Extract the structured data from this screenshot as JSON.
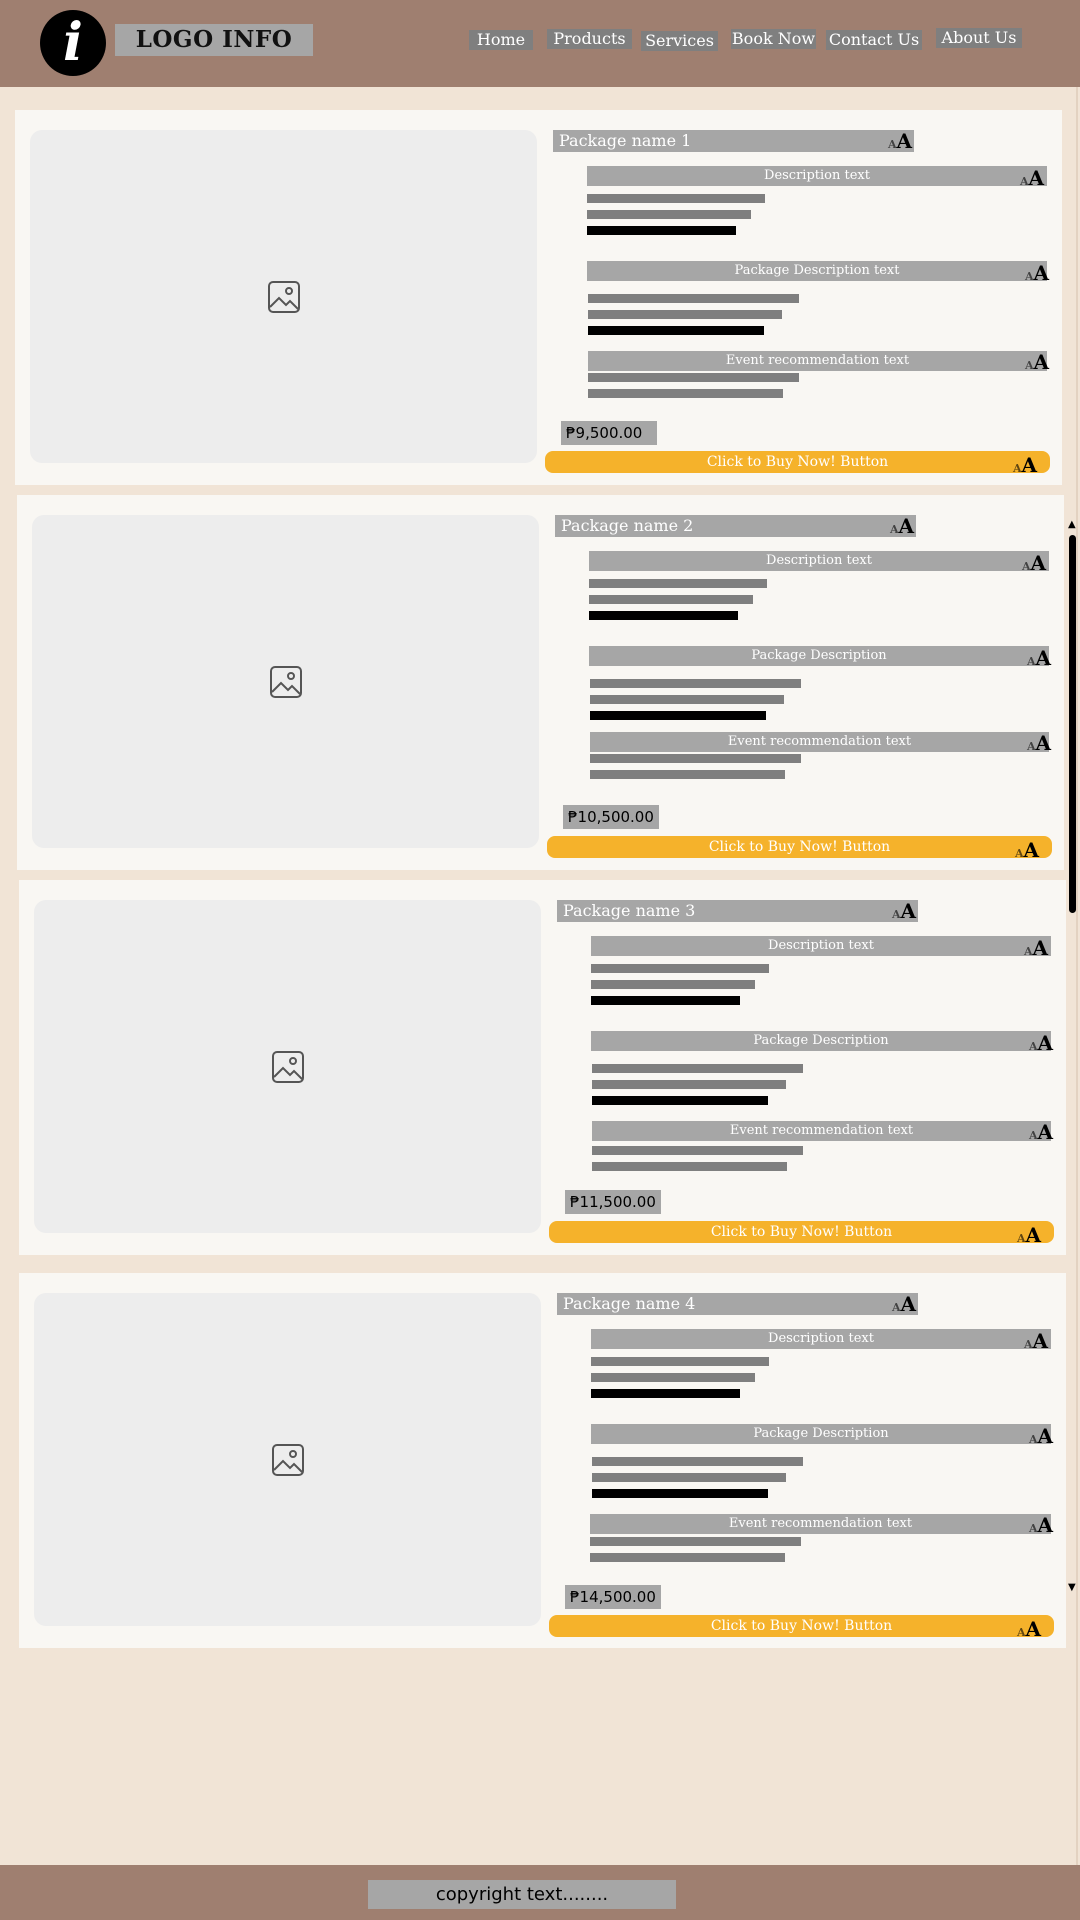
{
  "header": {
    "logo_glyph": "i",
    "logo_text": "LOGO INFO",
    "nav": [
      "Home",
      "Products",
      "Services",
      "Book Now",
      "Contact Us",
      "About Us"
    ]
  },
  "packages": [
    {
      "name": "Package name 1",
      "description_label": "Description text",
      "package_description_label": "Package Description text",
      "event_label": "Event recommendation text",
      "price": "₱9,500.00",
      "buy_label": "Click to Buy Now! Button"
    },
    {
      "name": "Package name 2",
      "description_label": "Description text",
      "package_description_label": "Package Description",
      "event_label": "Event recommendation text",
      "price": "₱10,500.00",
      "buy_label": "Click to Buy Now! Button"
    },
    {
      "name": "Package name 3",
      "description_label": "Description text",
      "package_description_label": "Package Description",
      "event_label": "Event recommendation text",
      "price": "₱11,500.00",
      "buy_label": "Click to Buy Now! Button"
    },
    {
      "name": "Package name 4",
      "description_label": "Description text",
      "package_description_label": "Package Description",
      "event_label": "Event recommendation text",
      "price": "₱14,500.00",
      "buy_label": "Click to Buy Now! Button"
    }
  ],
  "icons": {
    "logo": "info-icon",
    "image_placeholder": "image-icon",
    "font_tool": "font-size-icon",
    "scroll_up": "triangle-up-icon",
    "scroll_down": "triangle-down-icon"
  },
  "colors": {
    "header_bg": "#9f7f70",
    "page_bg": "#f1e4d6",
    "card_bg": "#f9f7f3",
    "label_bg": "#a6a6a6",
    "buy_button": "#f5b22b"
  },
  "footer": {
    "copyright": "copyright text........"
  }
}
